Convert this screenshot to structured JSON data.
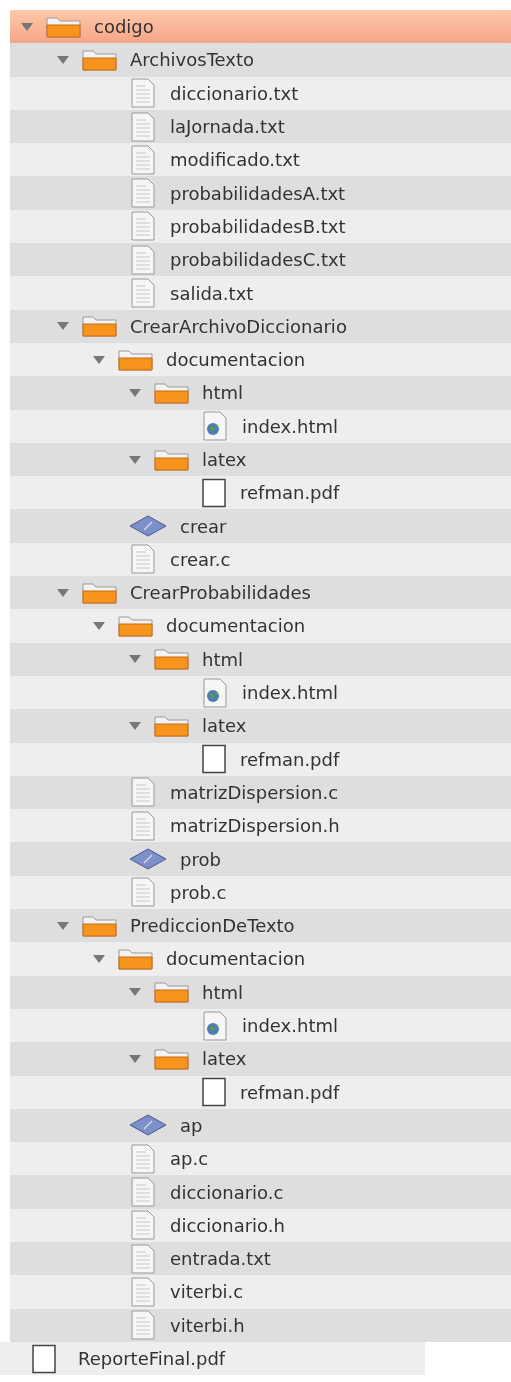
{
  "tree": [
    {
      "name": "codigo",
      "kind": "folder",
      "expanded": true,
      "selected": true,
      "children": [
        {
          "name": "ArchivosTexto",
          "kind": "folder",
          "expanded": true,
          "selected": false,
          "children": [
            {
              "name": "diccionario.txt",
              "kind": "text",
              "selected": false
            },
            {
              "name": "laJornada.txt",
              "kind": "text",
              "selected": false
            },
            {
              "name": "modificado.txt",
              "kind": "text",
              "selected": false
            },
            {
              "name": "probabilidadesA.txt",
              "kind": "text",
              "selected": false
            },
            {
              "name": "probabilidadesB.txt",
              "kind": "text",
              "selected": false
            },
            {
              "name": "probabilidadesC.txt",
              "kind": "text",
              "selected": false
            },
            {
              "name": "salida.txt",
              "kind": "text",
              "selected": false
            }
          ]
        },
        {
          "name": "CrearArchivoDiccionario",
          "kind": "folder",
          "expanded": true,
          "selected": false,
          "children": [
            {
              "name": "documentacion",
              "kind": "folder",
              "expanded": true,
              "selected": false,
              "children": [
                {
                  "name": "html",
                  "kind": "folder",
                  "expanded": true,
                  "selected": false,
                  "children": [
                    {
                      "name": "index.html",
                      "kind": "html",
                      "selected": false
                    }
                  ]
                },
                {
                  "name": "latex",
                  "kind": "folder",
                  "expanded": true,
                  "selected": false,
                  "children": [
                    {
                      "name": "refman.pdf",
                      "kind": "pdf",
                      "selected": false
                    }
                  ]
                }
              ]
            },
            {
              "name": "crear",
              "kind": "exec",
              "selected": false
            },
            {
              "name": "crear.c",
              "kind": "text",
              "selected": false
            }
          ]
        },
        {
          "name": "CrearProbabilidades",
          "kind": "folder",
          "expanded": true,
          "selected": false,
          "children": [
            {
              "name": "documentacion",
              "kind": "folder",
              "expanded": true,
              "selected": false,
              "children": [
                {
                  "name": "html",
                  "kind": "folder",
                  "expanded": true,
                  "selected": false,
                  "children": [
                    {
                      "name": "index.html",
                      "kind": "html",
                      "selected": false
                    }
                  ]
                },
                {
                  "name": "latex",
                  "kind": "folder",
                  "expanded": true,
                  "selected": false,
                  "children": [
                    {
                      "name": "refman.pdf",
                      "kind": "pdf",
                      "selected": false
                    }
                  ]
                }
              ]
            },
            {
              "name": "matrizDispersion.c",
              "kind": "text",
              "selected": false
            },
            {
              "name": "matrizDispersion.h",
              "kind": "text",
              "selected": false
            },
            {
              "name": "prob",
              "kind": "exec",
              "selected": false
            },
            {
              "name": "prob.c",
              "kind": "text",
              "selected": false
            }
          ]
        },
        {
          "name": "PrediccionDeTexto",
          "kind": "folder",
          "expanded": true,
          "selected": false,
          "children": [
            {
              "name": "documentacion",
              "kind": "folder",
              "expanded": true,
              "selected": false,
              "children": [
                {
                  "name": "html",
                  "kind": "folder",
                  "expanded": true,
                  "selected": false,
                  "children": [
                    {
                      "name": "index.html",
                      "kind": "html",
                      "selected": false
                    }
                  ]
                },
                {
                  "name": "latex",
                  "kind": "folder",
                  "expanded": true,
                  "selected": false,
                  "children": [
                    {
                      "name": "refman.pdf",
                      "kind": "pdf",
                      "selected": false
                    }
                  ]
                }
              ]
            },
            {
              "name": "ap",
              "kind": "exec",
              "selected": false
            },
            {
              "name": "ap.c",
              "kind": "text",
              "selected": false
            },
            {
              "name": "diccionario.c",
              "kind": "text",
              "selected": false
            },
            {
              "name": "diccionario.h",
              "kind": "text",
              "selected": false
            },
            {
              "name": "entrada.txt",
              "kind": "text",
              "selected": false
            },
            {
              "name": "viterbi.c",
              "kind": "text",
              "selected": false
            },
            {
              "name": "viterbi.h",
              "kind": "text",
              "selected": false
            }
          ]
        }
      ]
    }
  ],
  "loose_file": {
    "name": "ReporteFinal.pdf",
    "kind": "pdf"
  }
}
